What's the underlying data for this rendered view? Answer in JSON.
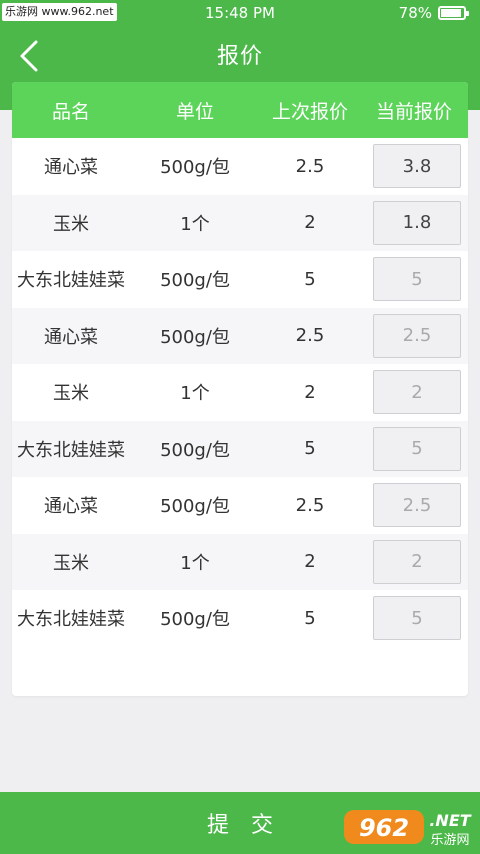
{
  "status": {
    "watermark": "乐游网 www.962.net",
    "time": "15:48 PM",
    "battery": "78%",
    "battery_level": 0.78
  },
  "header": {
    "title": "报价"
  },
  "table": {
    "columns": [
      "品名",
      "单位",
      "上次报价",
      "当前报价"
    ],
    "rows": [
      {
        "name": "通心菜",
        "unit": "500g/包",
        "last": "2.5",
        "current": "3.8",
        "placeholder": ""
      },
      {
        "name": "玉米",
        "unit": "1个",
        "last": "2",
        "current": "1.8",
        "placeholder": ""
      },
      {
        "name": "大东北娃娃菜",
        "unit": "500g/包",
        "last": "5",
        "current": "",
        "placeholder": "5"
      },
      {
        "name": "通心菜",
        "unit": "500g/包",
        "last": "2.5",
        "current": "",
        "placeholder": "2.5"
      },
      {
        "name": "玉米",
        "unit": "1个",
        "last": "2",
        "current": "",
        "placeholder": "2"
      },
      {
        "name": "大东北娃娃菜",
        "unit": "500g/包",
        "last": "5",
        "current": "",
        "placeholder": "5"
      },
      {
        "name": "通心菜",
        "unit": "500g/包",
        "last": "2.5",
        "current": "",
        "placeholder": "2.5"
      },
      {
        "name": "玉米",
        "unit": "1个",
        "last": "2",
        "current": "",
        "placeholder": "2"
      },
      {
        "name": "大东北娃娃菜",
        "unit": "500g/包",
        "last": "5",
        "current": "",
        "placeholder": "5"
      }
    ]
  },
  "footer": {
    "submit_label": "提交"
  },
  "watermark_logo": {
    "text": "962.NET",
    "subtext": "乐游网"
  },
  "colors": {
    "header": "#4cb84a",
    "table_header": "#5cd45a",
    "background": "#efeff1"
  }
}
